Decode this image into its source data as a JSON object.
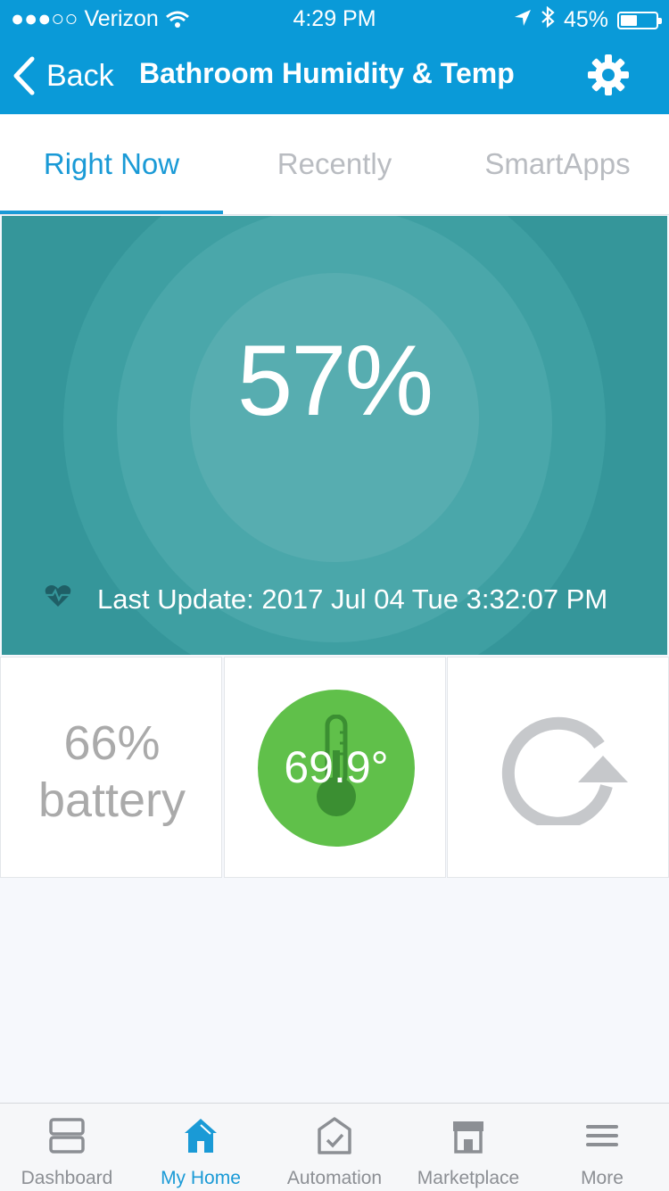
{
  "status_bar": {
    "carrier": "●●●○○ Verizon",
    "time": "4:29 PM",
    "battery": "45%"
  },
  "nav": {
    "back_label": "Back",
    "title": "Bathroom Humidity & Temp"
  },
  "tabs": [
    {
      "label": "Right Now",
      "active": true
    },
    {
      "label": "Recently",
      "active": false
    },
    {
      "label": "SmartApps",
      "active": false
    }
  ],
  "main_tile": {
    "humidity": "57%",
    "last_update": "Last Update: 2017 Jul 04 Tue 3:32:07 PM"
  },
  "tiles": {
    "battery_percent": "66%",
    "battery_label": "battery",
    "temperature": "69.9°"
  },
  "bottom_nav": [
    {
      "label": "Dashboard",
      "icon": "dashboard-icon",
      "active": false
    },
    {
      "label": "My Home",
      "icon": "home-icon",
      "active": true
    },
    {
      "label": "Automation",
      "icon": "automation-icon",
      "active": false
    },
    {
      "label": "Marketplace",
      "icon": "marketplace-icon",
      "active": false
    },
    {
      "label": "More",
      "icon": "menu-icon",
      "active": false
    }
  ],
  "colors": {
    "header": "#0a9ad8",
    "accent": "#1a9ad6",
    "tile_teal": "#35969a",
    "temp_green": "#60c04a"
  }
}
